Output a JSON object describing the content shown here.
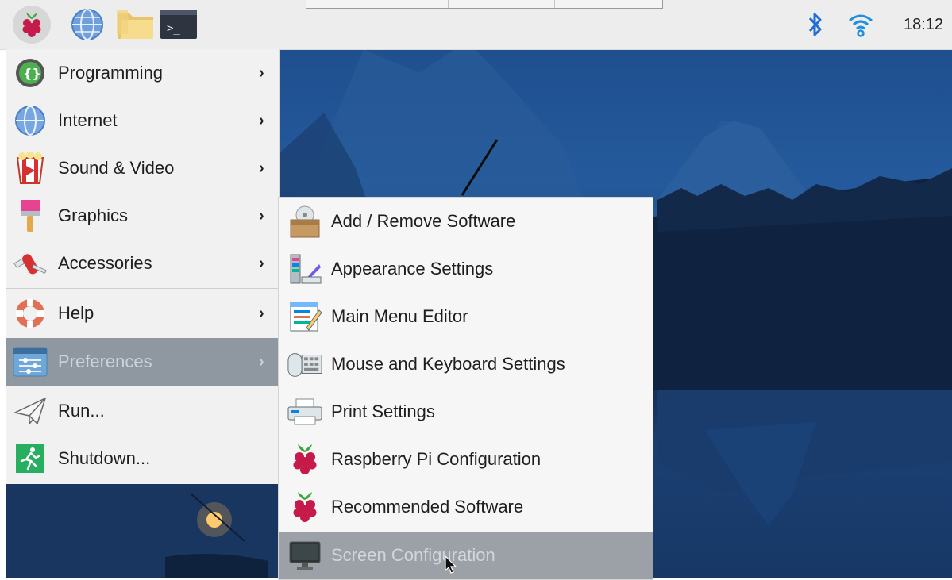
{
  "taskbar": {
    "clock": "18:12",
    "launchers": [
      {
        "name": "raspberry-menu-icon"
      },
      {
        "name": "web-browser-icon"
      },
      {
        "name": "file-manager-icon"
      },
      {
        "name": "terminal-icon"
      }
    ],
    "tray": [
      "bluetooth-icon",
      "wifi-icon"
    ]
  },
  "menu": {
    "items": [
      {
        "label": "Programming",
        "icon": "programming-icon",
        "submenu": true
      },
      {
        "label": "Internet",
        "icon": "globe-icon",
        "submenu": true
      },
      {
        "label": "Sound & Video",
        "icon": "popcorn-icon",
        "submenu": true
      },
      {
        "label": "Graphics",
        "icon": "paintbrush-icon",
        "submenu": true
      },
      {
        "label": "Accessories",
        "icon": "pocket-knife-icon",
        "submenu": true
      },
      {
        "label": "Help",
        "icon": "lifebuoy-icon",
        "submenu": true
      },
      {
        "label": "Preferences",
        "icon": "preferences-icon",
        "submenu": true,
        "active": true
      },
      {
        "label": "Run...",
        "icon": "paper-plane-icon",
        "submenu": false
      },
      {
        "label": "Shutdown...",
        "icon": "exit-icon",
        "submenu": false
      }
    ]
  },
  "submenu": {
    "items": [
      {
        "label": "Add / Remove Software",
        "icon": "package-icon"
      },
      {
        "label": "Appearance Settings",
        "icon": "appearance-icon"
      },
      {
        "label": "Main Menu Editor",
        "icon": "menu-editor-icon"
      },
      {
        "label": "Mouse and Keyboard Settings",
        "icon": "mouse-keyboard-icon"
      },
      {
        "label": "Print Settings",
        "icon": "printer-icon"
      },
      {
        "label": "Raspberry Pi Configuration",
        "icon": "raspberry-icon"
      },
      {
        "label": "Recommended Software",
        "icon": "raspberry-icon"
      },
      {
        "label": "Screen Configuration",
        "icon": "monitor-icon",
        "active": true
      }
    ]
  },
  "colors": {
    "menu_bg": "#f1f1f1",
    "active_bg": "#8f97a0",
    "taskbar_bg": "#ededed",
    "bluetooth": "#1f6fd6",
    "wifi": "#1f8fe0"
  }
}
